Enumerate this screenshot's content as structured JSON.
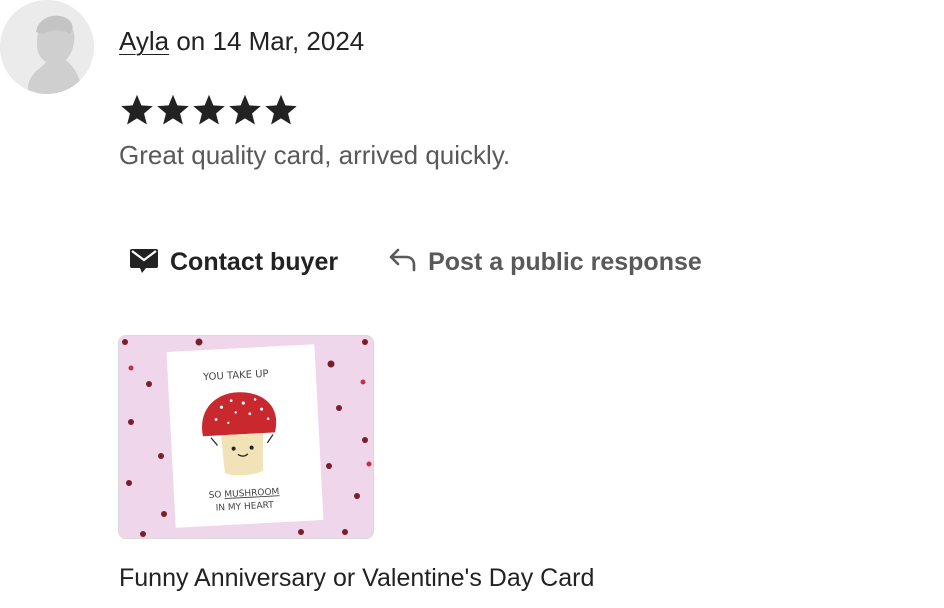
{
  "review": {
    "reviewer_name": "Ayla",
    "date_prefix": " on ",
    "date": "14 Mar, 2024",
    "rating": 5,
    "rating_max": 5,
    "text": "Great quality card, arrived quickly."
  },
  "actions": {
    "contact_label": "Contact buyer",
    "contact_icon": "mail-icon",
    "public_label": "Post a public response",
    "public_icon": "reply-arrow-icon"
  },
  "product": {
    "title": "Funny Anniversary or Valentine's Day Card",
    "card_line1": "YOU TAKE UP",
    "card_line2_prefix": "SO ",
    "card_line2_word": "MUSHROOM",
    "card_line3": "IN MY HEART"
  },
  "colors": {
    "text": "#222222",
    "muted": "#595959",
    "thumb_bg": "#efd6ea",
    "mushroom": "#c8282e"
  }
}
